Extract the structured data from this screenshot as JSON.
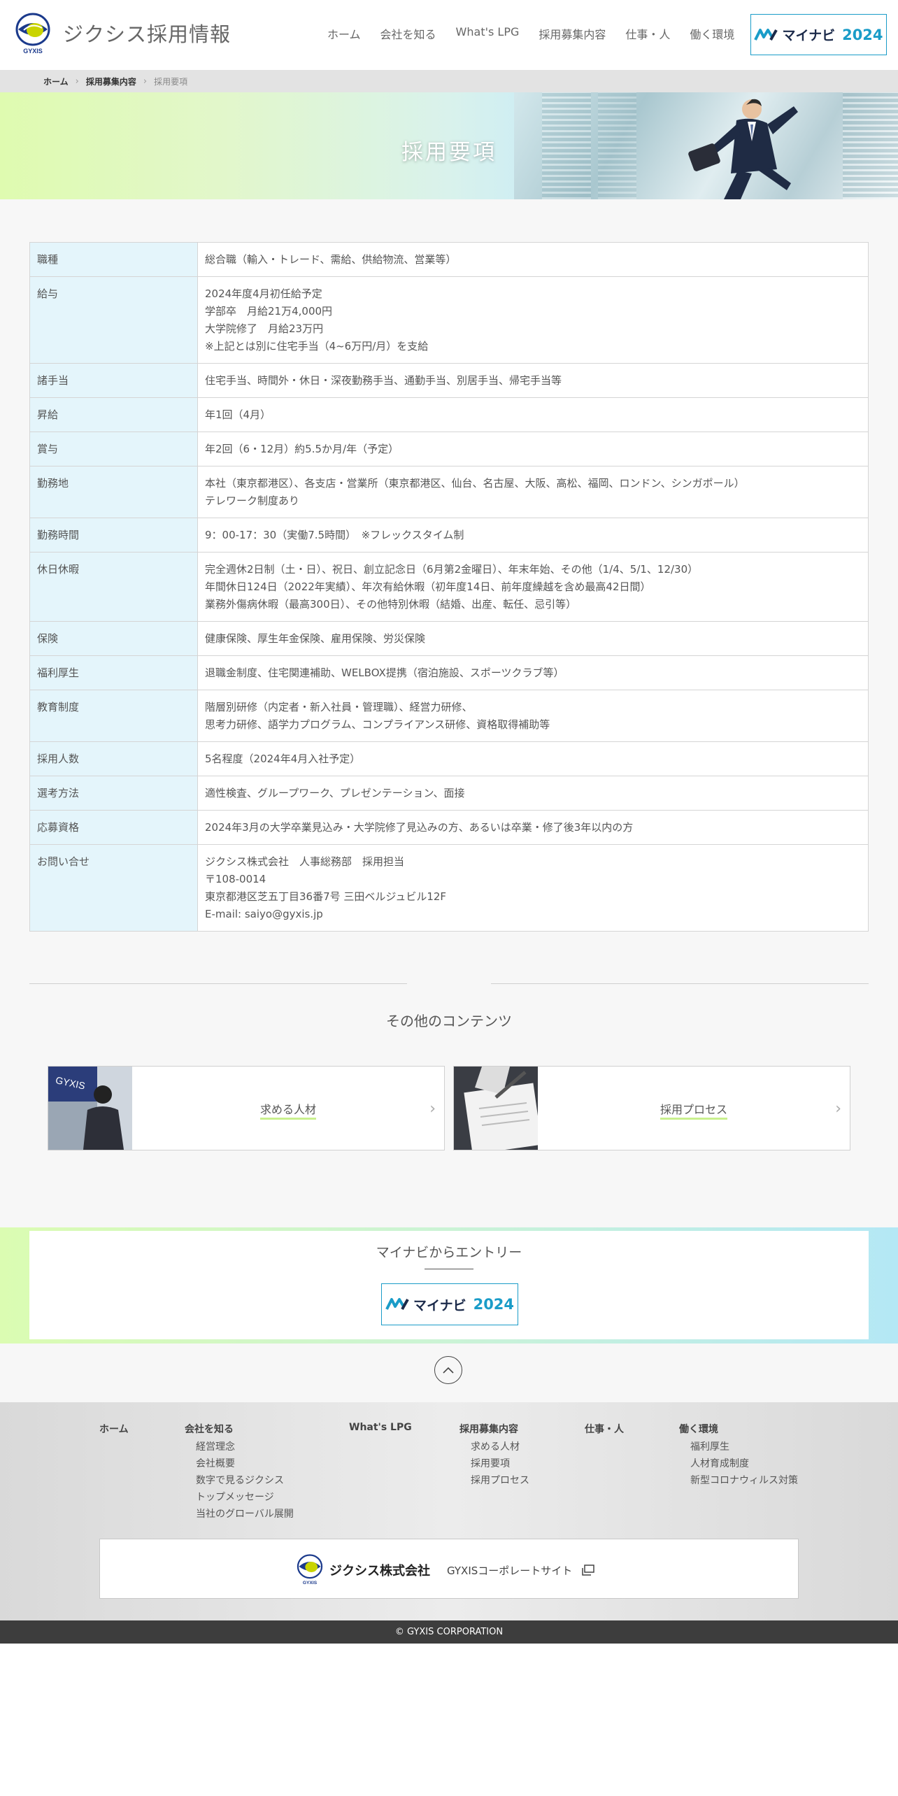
{
  "header": {
    "site_title": "ジクシス採用情報",
    "logo_text": "GYXIS",
    "nav": [
      "ホーム",
      "会社を知る",
      "What's LPG",
      "採用募集内容",
      "仕事・人",
      "働く環境"
    ],
    "mynavi": {
      "text": "マイナビ",
      "year": "2024"
    }
  },
  "breadcrumb": {
    "home": "ホーム",
    "parent": "採用募集内容",
    "current": "採用要項"
  },
  "hero": {
    "title": "採用要項"
  },
  "requirements": [
    {
      "label": "職種",
      "lines": [
        "総合職（輸入・トレード、需給、供給物流、営業等）"
      ]
    },
    {
      "label": "給与",
      "lines": [
        "2024年度4月初任給予定",
        "学部卒　月給21万4,000円",
        "大学院修了　月給23万円",
        "※上記とは別に住宅手当（4~6万円/月）を支給"
      ]
    },
    {
      "label": "諸手当",
      "lines": [
        "住宅手当、時間外・休日・深夜勤務手当、通勤手当、別居手当、帰宅手当等"
      ]
    },
    {
      "label": "昇給",
      "lines": [
        "年1回（4月）"
      ]
    },
    {
      "label": "賞与",
      "lines": [
        "年2回（6・12月）約5.5か月/年（予定）"
      ]
    },
    {
      "label": "勤務地",
      "lines": [
        "本社（東京都港区）、各支店・営業所（東京都港区、仙台、名古屋、大阪、高松、福岡、ロンドン、シンガポール）",
        "テレワーク制度あり"
      ]
    },
    {
      "label": "勤務時間",
      "lines": [
        "9：00-17：30（実働7.5時間）　※フレックスタイム制"
      ]
    },
    {
      "label": "休日休暇",
      "lines": [
        "完全週休2日制（土・日）、祝日、創立記念日（6月第2金曜日）、年末年始、その他（1/4、5/1、12/30）",
        "年間休日124日（2022年実績）、年次有給休暇（初年度14日、前年度繰越を含め最高42日間）",
        "業務外傷病休暇（最高300日）、その他特別休暇（結婚、出産、転任、忌引等）"
      ]
    },
    {
      "label": "保険",
      "lines": [
        "健康保険、厚生年金保険、雇用保険、労災保険"
      ]
    },
    {
      "label": "福利厚生",
      "lines": [
        "退職金制度、住宅関連補助、WELBOX提携（宿泊施設、スポーツクラブ等）"
      ]
    },
    {
      "label": "教育制度",
      "lines": [
        "階層別研修（内定者・新入社員・管理職）、経営力研修、",
        "思考力研修、語学力プログラム、コンプライアンス研修、資格取得補助等"
      ]
    },
    {
      "label": "採用人数",
      "lines": [
        "5名程度（2024年4月入社予定）"
      ]
    },
    {
      "label": "選考方法",
      "lines": [
        "適性検査、グループワーク、プレゼンテーション、面接"
      ]
    },
    {
      "label": "応募資格",
      "lines": [
        "2024年3月の大学卒業見込み・大学院修了見込みの方、あるいは卒業・修了後3年以内の方"
      ]
    },
    {
      "label": "お問い合せ",
      "lines": [
        "ジクシス株式会社　人事総務部　採用担当",
        "〒108-0014",
        "東京都港区芝五丁目36番7号 三田ベルジュビル12F",
        "E-mail: saiyo@gyxis.jp"
      ]
    }
  ],
  "other": {
    "title": "その他のコンテンツ",
    "cards": [
      {
        "label": "求める人材"
      },
      {
        "label": "採用プロセス"
      }
    ]
  },
  "entry": {
    "title": "マイナビからエントリー"
  },
  "footer": {
    "cols": [
      {
        "head": "ホーム",
        "items": []
      },
      {
        "head": "会社を知る",
        "items": [
          "経営理念",
          "会社概要",
          "数字で見るジクシス",
          "トップメッセージ",
          "当社のグローバル展開"
        ]
      },
      {
        "head": "What's LPG",
        "items": []
      },
      {
        "head": "採用募集内容",
        "items": [
          "求める人材",
          "採用要項",
          "採用プロセス"
        ]
      },
      {
        "head": "仕事・人",
        "items": []
      },
      {
        "head": "働く環境",
        "items": [
          "福利厚生",
          "人材育成制度",
          "新型コロナウィルス対策"
        ]
      }
    ],
    "corp_name": "ジクシス株式会社",
    "corp_link": "GYXISコーポレートサイト",
    "copyright": "© GYXIS CORPORATION"
  },
  "colors": {
    "accent_blue": "#1a9cc8",
    "table_label_bg": "#e4f5fb",
    "footer_bar": "#3d3d3d",
    "underline_green": "#c9f08e"
  }
}
